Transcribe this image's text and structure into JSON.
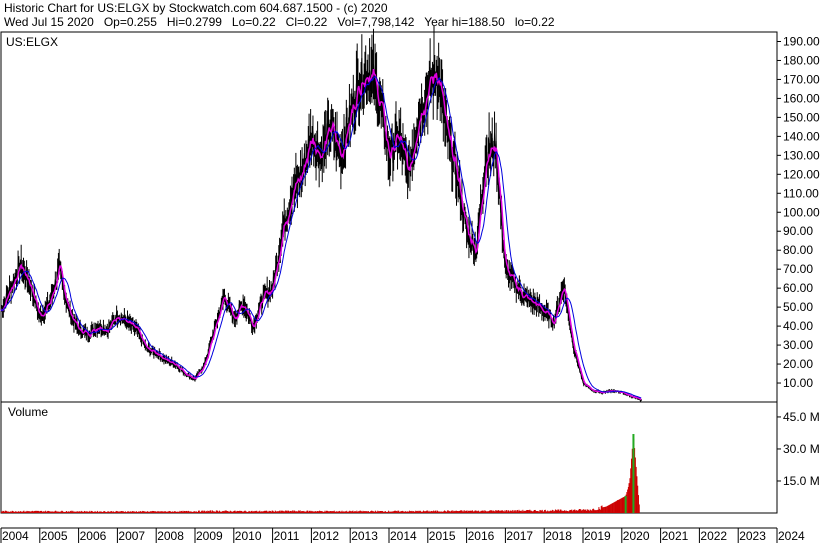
{
  "header": {
    "line1": "Historic Chart for US:ELGX by Stockwatch.com 604.687.1500 - (c) 2020",
    "line2": "Wed Jul 15 2020   Op=0.255   Hi=0.2799   Lo=0.22   Cl=0.22   Vol=7,798,142   Year hi=188.50   lo=0.22"
  },
  "chart_data": [
    {
      "type": "line",
      "panel": "price",
      "title": "US:ELGX",
      "ylim": [
        0,
        195
      ],
      "yticks": [
        10,
        20,
        30,
        40,
        50,
        60,
        70,
        80,
        90,
        100,
        110,
        120,
        130,
        140,
        150,
        160,
        170,
        180,
        190
      ],
      "ytick_labels": [
        "10.00",
        "20.00",
        "30.00",
        "40.00",
        "50.00",
        "60.00",
        "70.00",
        "80.00",
        "90.00",
        "100.00",
        "110.00",
        "120.00",
        "130.00",
        "140.00",
        "150.00",
        "160.00",
        "170.00",
        "180.00",
        "190.00"
      ],
      "xlim": [
        2004.0,
        2024.0
      ],
      "x_labels": [
        "2004",
        "2005",
        "2006",
        "2007",
        "2008",
        "2009",
        "2010",
        "2011",
        "2012",
        "2013",
        "2014",
        "2015",
        "2016",
        "2017",
        "2018",
        "2019",
        "2020",
        "2021",
        "2022",
        "2023",
        "2024"
      ],
      "grid": false,
      "series": [
        {
          "color": "#000000",
          "x": [
            2004.0,
            2004.25,
            2004.5,
            2004.75,
            2005.0,
            2005.25,
            2005.5,
            2005.75,
            2006.0,
            2006.25,
            2006.5,
            2006.75,
            2007.0,
            2007.25,
            2007.5,
            2007.75,
            2008.0,
            2008.25,
            2008.5,
            2008.75,
            2009.0,
            2009.25,
            2009.5,
            2009.75,
            2010.0,
            2010.25,
            2010.5,
            2010.75,
            2011.0,
            2011.25,
            2011.5,
            2011.75,
            2012.0,
            2012.25,
            2012.5,
            2012.75,
            2013.0,
            2013.25,
            2013.5,
            2013.75,
            2014.0,
            2014.25,
            2014.5,
            2014.75,
            2015.0,
            2015.25,
            2015.5,
            2015.75,
            2016.0,
            2016.25,
            2016.5,
            2016.75,
            2017.0,
            2017.25,
            2017.5,
            2017.75,
            2018.0,
            2018.25,
            2018.5,
            2018.75,
            2019.0,
            2019.25,
            2019.5,
            2019.75,
            2020.0,
            2020.25,
            2020.5
          ],
          "values": [
            48,
            60,
            72,
            62,
            45,
            52,
            70,
            48,
            38,
            36,
            40,
            38,
            46,
            42,
            38,
            28,
            26,
            22,
            20,
            15,
            12,
            20,
            38,
            56,
            44,
            52,
            40,
            55,
            60,
            90,
            110,
            120,
            140,
            130,
            145,
            130,
            150,
            170,
            175,
            160,
            130,
            140,
            120,
            150,
            165,
            175,
            140,
            120,
            90,
            80,
            130,
            135,
            70,
            62,
            55,
            52,
            48,
            42,
            62,
            30,
            10,
            6,
            5,
            6,
            5,
            3,
            1
          ]
        }
      ]
    },
    {
      "type": "bar",
      "panel": "volume",
      "title": "Volume",
      "ylim": [
        0,
        52
      ],
      "yticks": [
        15,
        30,
        45
      ],
      "ytick_labels": [
        "15.0 M",
        "30.0 M",
        "45.0 M"
      ],
      "x": [
        2004.5,
        2005.5,
        2006.5,
        2007.5,
        2008.5,
        2009.5,
        2010.5,
        2011.5,
        2012.5,
        2013.5,
        2014.5,
        2015.5,
        2016.5,
        2017.5,
        2018.5,
        2019.2,
        2019.6,
        2019.9,
        2020.1,
        2020.2,
        2020.3,
        2020.45
      ],
      "values": [
        0.8,
        0.8,
        0.7,
        0.7,
        0.7,
        0.9,
        0.8,
        0.9,
        0.8,
        0.8,
        0.8,
        0.9,
        1.0,
        1.1,
        1.2,
        1.5,
        3.0,
        6.0,
        8.0,
        14.0,
        37.0,
        4.0
      ]
    }
  ]
}
